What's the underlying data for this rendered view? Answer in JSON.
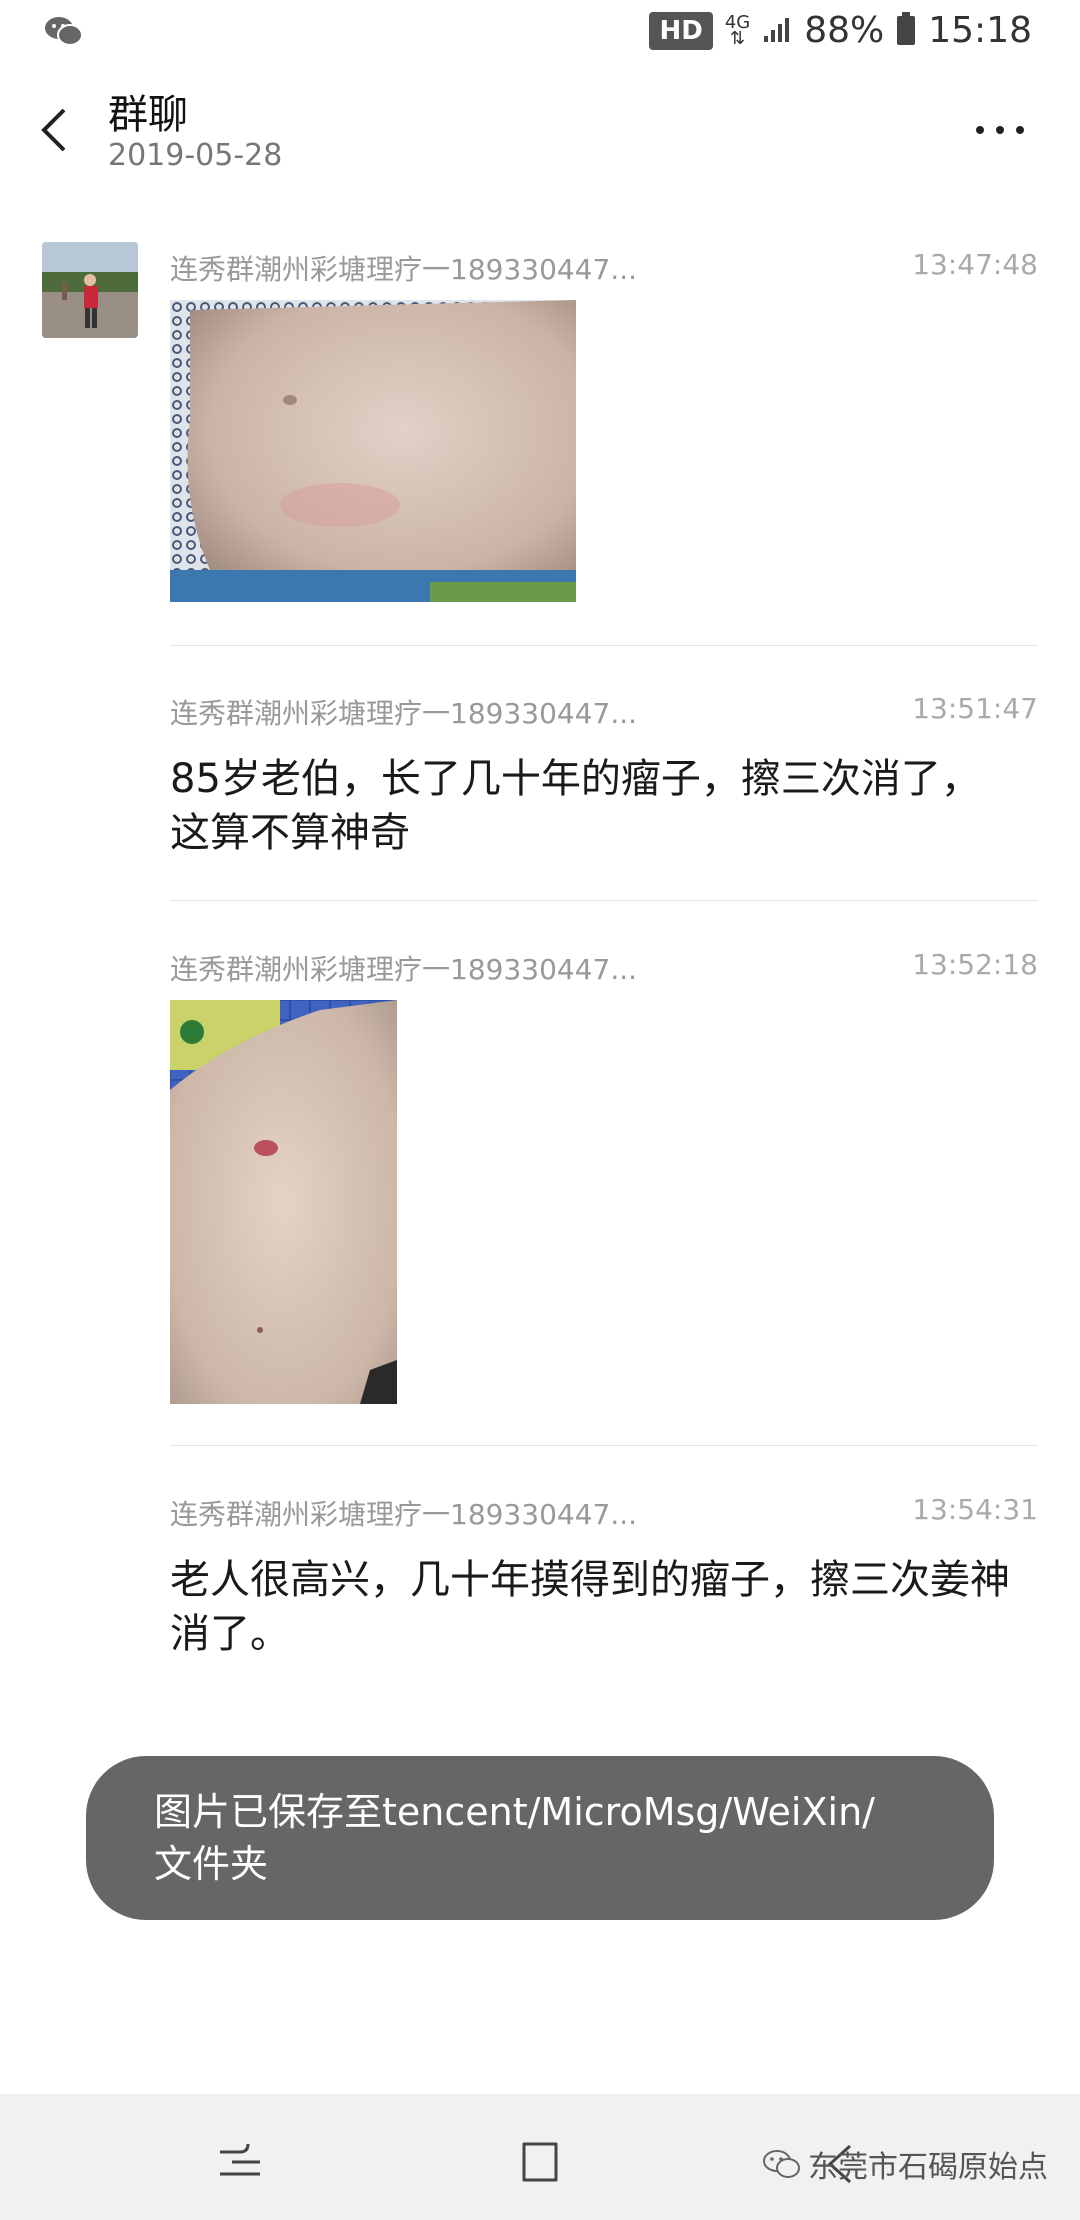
{
  "status_bar": {
    "hd": "HD",
    "network": "4G",
    "battery": "88%",
    "time": "15:18"
  },
  "header": {
    "title": "群聊",
    "date": "2019-05-28"
  },
  "messages": [
    {
      "sender": "连秀群潮州彩塘理疗一189330447...",
      "time": "13:47:48",
      "type": "image",
      "alt": ""
    },
    {
      "sender": "连秀群潮州彩塘理疗一189330447...",
      "time": "13:51:47",
      "type": "text",
      "text": "85岁老伯，长了几十年的瘤子，擦三次消了，这算不算神奇"
    },
    {
      "sender": "连秀群潮州彩塘理疗一189330447...",
      "time": "13:52:18",
      "type": "image",
      "alt": ""
    },
    {
      "sender": "连秀群潮州彩塘理疗一189330447...",
      "time": "13:54:31",
      "type": "text",
      "text": "老人很高兴，几十年摸得到的瘤子，擦三次姜神消了。"
    }
  ],
  "toast": {
    "text": "图片已保存至tencent/MicroMsg/WeiXin/ 文件夹"
  },
  "watermark": {
    "text": "东莞市石碣原始点"
  },
  "colors": {
    "toast_bg": "#666666",
    "nav_bg": "#f1f1f1"
  }
}
